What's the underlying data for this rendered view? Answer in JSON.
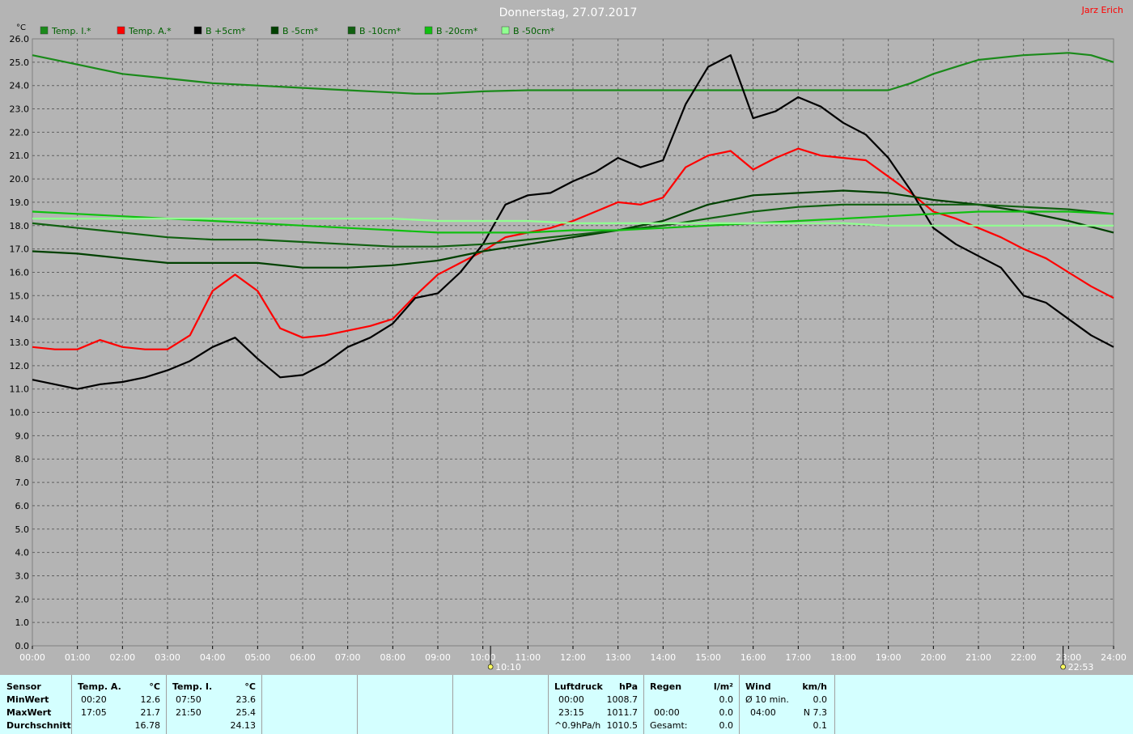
{
  "window": {
    "title": "Donnerstag, 27.07.2017",
    "author": "Jarz Erich"
  },
  "colors": {
    "plot_bg": "#b4b4b4",
    "temp_i": "#1a8a1a",
    "temp_a": "#ff0000",
    "b_p5": "#000000",
    "b_m5": "#004000",
    "b_m10": "#106010",
    "b_m20": "#10c010",
    "b_m50": "#90ff90",
    "table_bg": "#d4ffff"
  },
  "chart_data": {
    "type": "line",
    "ylabel": "°C",
    "ylim": [
      0,
      26
    ],
    "xlim": [
      0,
      24
    ],
    "grid": true,
    "legend": "top-left",
    "x_ticks": [
      "00:00",
      "01:00",
      "02:00",
      "03:00",
      "04:00",
      "05:00",
      "06:00",
      "07:00",
      "08:00",
      "09:00",
      "10:00",
      "11:00",
      "12:00",
      "13:00",
      "14:00",
      "15:00",
      "16:00",
      "17:00",
      "18:00",
      "19:00",
      "20:00",
      "21:00",
      "22:00",
      "23:00",
      "24:00"
    ],
    "y_ticks": [
      "0.0",
      "1.0",
      "2.0",
      "3.0",
      "4.0",
      "5.0",
      "6.0",
      "7.0",
      "8.0",
      "9.0",
      "10.0",
      "11.0",
      "12.0",
      "13.0",
      "14.0",
      "15.0",
      "16.0",
      "17.0",
      "18.0",
      "19.0",
      "20.0",
      "21.0",
      "22.0",
      "23.0",
      "24.0",
      "25.0",
      "26.0"
    ],
    "markers": [
      {
        "x": 10.17,
        "label": "10:10"
      },
      {
        "x": 22.88,
        "label": "22:53"
      }
    ],
    "series": [
      {
        "name": "Temp. I.*",
        "color_key": "temp_i",
        "x": [
          0,
          1,
          2,
          3,
          4,
          5,
          6,
          7,
          8,
          8.5,
          9,
          10,
          11,
          12,
          13,
          14,
          15,
          16,
          17,
          18,
          18.5,
          19,
          19.5,
          20,
          20.5,
          21,
          22,
          23,
          23.5,
          24
        ],
        "y": [
          25.3,
          24.9,
          24.5,
          24.3,
          24.1,
          24.0,
          23.9,
          23.8,
          23.7,
          23.65,
          23.65,
          23.75,
          23.8,
          23.8,
          23.8,
          23.8,
          23.8,
          23.8,
          23.8,
          23.8,
          23.8,
          23.8,
          24.1,
          24.5,
          24.8,
          25.1,
          25.3,
          25.4,
          25.3,
          25.0
        ]
      },
      {
        "name": "Temp. A.*",
        "color_key": "temp_a",
        "x": [
          0,
          0.5,
          1,
          1.5,
          2,
          2.5,
          3,
          3.5,
          4,
          4.5,
          5,
          5.5,
          6,
          6.5,
          7,
          7.5,
          8,
          8.5,
          9,
          9.5,
          10,
          10.5,
          11,
          11.5,
          12,
          12.5,
          13,
          13.5,
          14,
          14.5,
          15,
          15.5,
          16,
          16.5,
          17,
          17.5,
          18,
          18.5,
          19,
          19.5,
          20,
          20.5,
          21,
          21.5,
          22,
          22.5,
          23,
          23.5,
          24
        ],
        "y": [
          12.8,
          12.7,
          12.7,
          13.1,
          12.8,
          12.7,
          12.7,
          13.3,
          15.2,
          15.9,
          15.2,
          13.6,
          13.2,
          13.3,
          13.5,
          13.7,
          14.0,
          15.0,
          15.9,
          16.4,
          16.9,
          17.5,
          17.7,
          17.9,
          18.2,
          18.6,
          19.0,
          18.9,
          19.2,
          20.5,
          21.0,
          21.2,
          20.4,
          20.9,
          21.3,
          21.0,
          20.9,
          20.8,
          20.1,
          19.4,
          18.6,
          18.3,
          17.9,
          17.5,
          17.0,
          16.6,
          16.0,
          15.4,
          14.9
        ]
      },
      {
        "name": "B +5cm*",
        "color_key": "b_p5",
        "x": [
          0,
          0.5,
          1,
          1.5,
          2,
          2.5,
          3,
          3.5,
          4,
          4.5,
          5,
          5.5,
          6,
          6.5,
          7,
          7.5,
          8,
          8.5,
          9,
          9.5,
          10,
          10.5,
          11,
          11.5,
          12,
          12.5,
          13,
          13.5,
          14,
          14.5,
          15,
          15.5,
          16,
          16.5,
          17,
          17.5,
          18,
          18.5,
          19,
          19.5,
          20,
          20.5,
          21,
          21.5,
          22,
          22.5,
          23,
          23.5,
          24
        ],
        "y": [
          11.4,
          11.2,
          11.0,
          11.2,
          11.3,
          11.5,
          11.8,
          12.2,
          12.8,
          13.2,
          12.3,
          11.5,
          11.6,
          12.1,
          12.8,
          13.2,
          13.8,
          14.9,
          15.1,
          16.0,
          17.2,
          18.9,
          19.3,
          19.4,
          19.9,
          20.3,
          20.9,
          20.5,
          20.8,
          23.2,
          24.8,
          25.3,
          22.6,
          22.9,
          23.5,
          23.1,
          22.4,
          21.9,
          20.9,
          19.5,
          17.9,
          17.2,
          16.7,
          16.2,
          15.0,
          14.7,
          14.0,
          13.3,
          12.8
        ]
      },
      {
        "name": "B -5cm*",
        "color_key": "b_m5",
        "x": [
          0,
          1,
          2,
          3,
          4,
          5,
          6,
          7,
          8,
          9,
          10,
          11,
          12,
          13,
          14,
          15,
          16,
          17,
          18,
          19,
          20,
          21,
          22,
          23,
          24
        ],
        "y": [
          16.9,
          16.8,
          16.6,
          16.4,
          16.4,
          16.4,
          16.2,
          16.2,
          16.3,
          16.5,
          16.9,
          17.2,
          17.5,
          17.8,
          18.2,
          18.9,
          19.3,
          19.4,
          19.5,
          19.4,
          19.1,
          18.9,
          18.6,
          18.2,
          17.7
        ]
      },
      {
        "name": "B -10cm*",
        "color_key": "b_m10",
        "x": [
          0,
          1,
          2,
          3,
          4,
          5,
          6,
          7,
          8,
          9,
          10,
          11,
          12,
          13,
          14,
          15,
          16,
          17,
          18,
          19,
          20,
          21,
          22,
          23,
          24
        ],
        "y": [
          18.1,
          17.9,
          17.7,
          17.5,
          17.4,
          17.4,
          17.3,
          17.2,
          17.1,
          17.1,
          17.2,
          17.4,
          17.6,
          17.8,
          18.0,
          18.3,
          18.6,
          18.8,
          18.9,
          18.9,
          18.9,
          18.9,
          18.8,
          18.7,
          18.5
        ]
      },
      {
        "name": "B -20cm*",
        "color_key": "b_m20",
        "x": [
          0,
          1,
          2,
          3,
          4,
          5,
          6,
          7,
          8,
          9,
          10,
          11,
          12,
          13,
          14,
          15,
          16,
          17,
          18,
          19,
          20,
          21,
          22,
          23,
          24
        ],
        "y": [
          18.6,
          18.5,
          18.4,
          18.3,
          18.2,
          18.1,
          18.0,
          17.9,
          17.8,
          17.7,
          17.7,
          17.7,
          17.8,
          17.8,
          17.9,
          18.0,
          18.1,
          18.2,
          18.3,
          18.4,
          18.5,
          18.6,
          18.6,
          18.6,
          18.5
        ]
      },
      {
        "name": "B -50cm*",
        "color_key": "b_m50",
        "x": [
          0,
          1,
          2,
          3,
          4,
          5,
          6,
          7,
          8,
          9,
          10,
          11,
          12,
          13,
          14,
          15,
          16,
          17,
          18,
          19,
          20,
          21,
          22,
          23,
          24
        ],
        "y": [
          18.3,
          18.3,
          18.3,
          18.3,
          18.3,
          18.3,
          18.3,
          18.3,
          18.3,
          18.2,
          18.2,
          18.2,
          18.1,
          18.1,
          18.1,
          18.1,
          18.1,
          18.1,
          18.1,
          18.0,
          18.0,
          18.0,
          18.0,
          18.0,
          18.0
        ]
      }
    ]
  },
  "table": {
    "sensor": {
      "header": "Sensor",
      "min": "MinWert",
      "max": "MaxWert",
      "avg": "Durchschnitt"
    },
    "temp_a": {
      "header": "Temp. A.",
      "unit": "°C",
      "min_time": "00:20",
      "min_val": "12.6",
      "max_time": "17:05",
      "max_val": "21.7",
      "avg": "16.78"
    },
    "temp_i": {
      "header": "Temp. I.",
      "unit": "°C",
      "min_time": "07:50",
      "min_val": "23.6",
      "max_time": "21:50",
      "max_val": "25.4",
      "avg": "24.13"
    },
    "pressure": {
      "header": "Luftdruck",
      "unit": "hPa",
      "min_time": "00:00",
      "min_val": "1008.7",
      "max_time": "23:15",
      "max_val": "1011.7",
      "trend_label": "^0.9hPa/h",
      "avg": "1010.5"
    },
    "rain": {
      "header": "Regen",
      "unit": "l/m²",
      "min_val": "0.0",
      "max_time": "00:00",
      "max_val": "0.0",
      "total_label": "Gesamt:",
      "total": "0.0"
    },
    "wind": {
      "header": "Wind",
      "unit": "km/h",
      "avg_label": "Ø 10 min.",
      "avg_val": "0.0",
      "max_time": "04:00",
      "max_val": "N 7.3",
      "avg": "0.1"
    }
  }
}
